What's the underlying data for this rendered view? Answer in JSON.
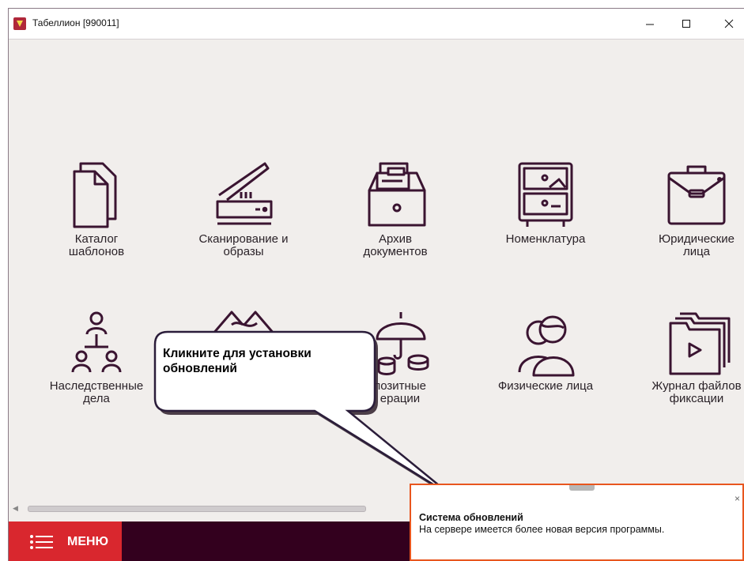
{
  "window": {
    "title": "Табеллион [990011]",
    "controls": {
      "minimize": "minimize-icon",
      "maximize": "maximize-icon",
      "close": "close-icon"
    }
  },
  "tiles": [
    {
      "label": "Каталог\nшаблонов",
      "icon": "documents-icon"
    },
    {
      "label": "Сканирование и\nобразы",
      "icon": "scanner-icon"
    },
    {
      "label": "Архив\nдокументов",
      "icon": "archive-drawer-icon"
    },
    {
      "label": "Номенклатура",
      "icon": "cabinet-icon"
    },
    {
      "label": "Юридические\nлица",
      "icon": "briefcase-icon"
    },
    {
      "label": "Наследственные\nдела",
      "icon": "hierarchy-people-icon"
    },
    {
      "label": "",
      "icon": "handshake-icon"
    },
    {
      "label": "позитные\nерации",
      "icon": "umbrella-coins-icon"
    },
    {
      "label": "Физические лица",
      "icon": "people-icon"
    },
    {
      "label": "Журнал файлов\nфиксации",
      "icon": "video-folder-icon"
    }
  ],
  "callout": {
    "text": "Кликните для установки обновлений"
  },
  "menu": {
    "label": "МЕНЮ",
    "icon": "list-icon"
  },
  "notification": {
    "title": "Система обновлений",
    "message": "На сервере имеется более новая версия программы.",
    "close": "×"
  },
  "colors": {
    "accent": "#d9272e",
    "bottom_bar": "#33001e",
    "icon_stroke": "#3a1431",
    "notification_border": "#e8561e"
  }
}
